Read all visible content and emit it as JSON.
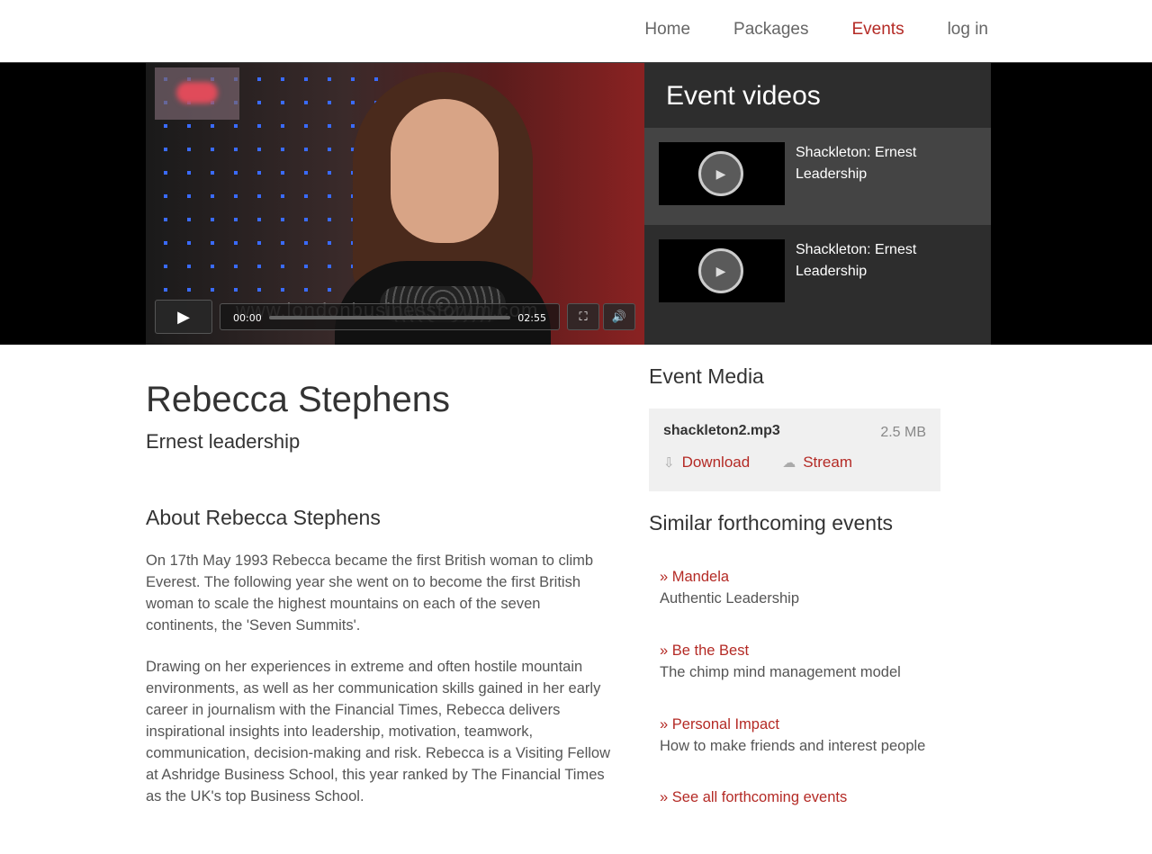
{
  "nav": {
    "items": [
      {
        "label": "Home"
      },
      {
        "label": "Packages"
      },
      {
        "label": "Events",
        "active": true
      },
      {
        "label": "log in"
      }
    ]
  },
  "player": {
    "time_current": "00:00",
    "time_total": "02:55",
    "watermark": "www.londonbusinessforum.com",
    "play_icon": "play-icon",
    "fullscreen_icon": "fullscreen-icon",
    "volume_icon": "volume-icon"
  },
  "event_videos": {
    "title": "Event videos",
    "items": [
      {
        "title": "Shackleton: Ernest Leadership"
      },
      {
        "title": "Shackleton: Ernest Leadership"
      }
    ]
  },
  "speaker": {
    "name": "Rebecca Stephens",
    "talk": "Ernest leadership",
    "about_heading": "About Rebecca Stephens",
    "bio_1": "On 17th May 1993 Rebecca became the first British woman to climb Everest. The following year she went on to become the first British woman to scale the highest mountains on each of the seven continents, the 'Seven Summits'.",
    "bio_2": "Drawing on her experiences in extreme and often hostile mountain environments, as well as her communication skills gained in her early career in journalism with the Financial Times, Rebecca delivers inspirational insights into leadership, motivation, teamwork, communication, decision-making and risk.  Rebecca is a Visiting Fellow at Ashridge Business School, this year ranked by The Financial Times as the UK's top Business School."
  },
  "event_media": {
    "title": "Event Media",
    "file_name": "shackleton2.mp3",
    "file_size": "2.5 MB",
    "download_label": "Download",
    "stream_label": "Stream"
  },
  "similar": {
    "title": "Similar forthcoming events",
    "events": [
      {
        "name": "» Mandela",
        "subtitle": "Authentic Leadership"
      },
      {
        "name": "» Be the Best",
        "subtitle": "The chimp mind management model"
      },
      {
        "name": "» Personal Impact",
        "subtitle": "How to make friends and interest people"
      }
    ],
    "see_all": "» See all forthcoming events"
  },
  "colors": {
    "accent": "#b42a25",
    "panel": "#2d2d2d"
  }
}
